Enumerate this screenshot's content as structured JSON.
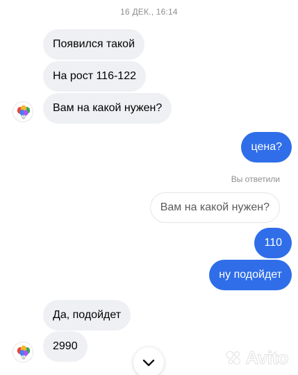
{
  "header": {
    "timestamp": "16 ДЕК., 16:14"
  },
  "messages": [
    {
      "text": "Появился такой"
    },
    {
      "text": "На рост 116-122"
    },
    {
      "text": "Вам на какой нужен?"
    },
    {
      "text": "цена?"
    },
    {
      "text": "Вам на какой нужен?"
    },
    {
      "text": "110"
    },
    {
      "text": "ну подойдет"
    },
    {
      "text": "Да, подойдет"
    },
    {
      "text": "2990"
    }
  ],
  "reply_label": "Вы ответили",
  "watermark": {
    "text": "Avito"
  },
  "colors": {
    "outgoing": "#2f6ee8",
    "incoming": "#eef0f3"
  },
  "icons": {
    "avatar": "balloons-icon",
    "scroll": "chevron-down-icon"
  }
}
